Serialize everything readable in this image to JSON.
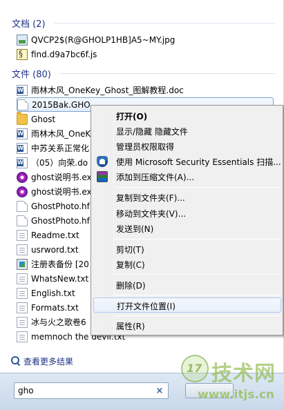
{
  "docs_group": {
    "header": "文档 (2)",
    "items": [
      {
        "name": "QVCP2$(R@GHOLP1HB]A5~MY.jpg",
        "icon": "image-file-icon"
      },
      {
        "name": "find.d9a7bc6f.js",
        "icon": "script-file-icon"
      }
    ]
  },
  "files_group": {
    "header": "文件 (80)",
    "items": [
      {
        "name": "雨林木风_OneKey_Ghost_图解教程.doc",
        "icon": "word-document-icon"
      },
      {
        "name": "2015Bak.GHO",
        "icon": "blank-file-icon",
        "selected": true
      },
      {
        "name": "Ghost",
        "icon": "folder-icon"
      },
      {
        "name": "雨林木风_OneK",
        "icon": "word-document-icon"
      },
      {
        "name": "中苏关系正常化",
        "icon": "word-document-icon"
      },
      {
        "name": "（05）向荣.do",
        "icon": "word-document-icon"
      },
      {
        "name": "ghost说明书.ex",
        "icon": "chm-help-icon"
      },
      {
        "name": "ghost说明书.ex",
        "icon": "chm-help-icon"
      },
      {
        "name": "GhostPhoto.hf",
        "icon": "blank-file-icon"
      },
      {
        "name": "GhostPhoto.hf",
        "icon": "blank-file-icon"
      },
      {
        "name": "Readme.txt",
        "icon": "text-file-icon"
      },
      {
        "name": "usrword.txt",
        "icon": "text-file-icon"
      },
      {
        "name": "注册表备份 [20",
        "icon": "registry-file-icon"
      },
      {
        "name": "WhatsNew.txt",
        "icon": "text-file-icon"
      },
      {
        "name": "English.txt",
        "icon": "text-file-icon"
      },
      {
        "name": "Formats.txt",
        "icon": "text-file-icon"
      },
      {
        "name": "冰与火之歌卷6",
        "icon": "text-file-icon"
      },
      {
        "name": "memnoch the devil.txt",
        "icon": "text-file-icon"
      }
    ]
  },
  "see_more": "查看更多结果",
  "search": {
    "value": "gho",
    "clear": "×"
  },
  "context_menu": {
    "items": [
      {
        "label": "打开(O)",
        "bold": true
      },
      {
        "label": "显示/隐藏 隐藏文件"
      },
      {
        "label": "管理员权限取得"
      },
      {
        "label": "使用 Microsoft Security Essentials 扫描...",
        "icon": "mse-shield-icon"
      },
      {
        "label": "添加到压缩文件(A)...",
        "icon": "winrar-archive-icon"
      },
      {
        "label": "复制到文件夹(F)..."
      },
      {
        "label": "移动到文件夹(V)..."
      },
      {
        "label": "发送到(N)"
      },
      {
        "label": "剪切(T)"
      },
      {
        "label": "复制(C)"
      },
      {
        "label": "删除(D)"
      },
      {
        "label": "打开文件位置(I)",
        "hover": true
      },
      {
        "label": "属性(R)"
      }
    ]
  },
  "watermark": {
    "logo_text": "17",
    "title": "技术网",
    "url": "www.itjs.cn"
  },
  "colors": {
    "header_blue": "#1e3287",
    "selection_border": "#7da2ce",
    "menu_bg": "#f0f0f0",
    "watermark_green": "#8cb946"
  }
}
